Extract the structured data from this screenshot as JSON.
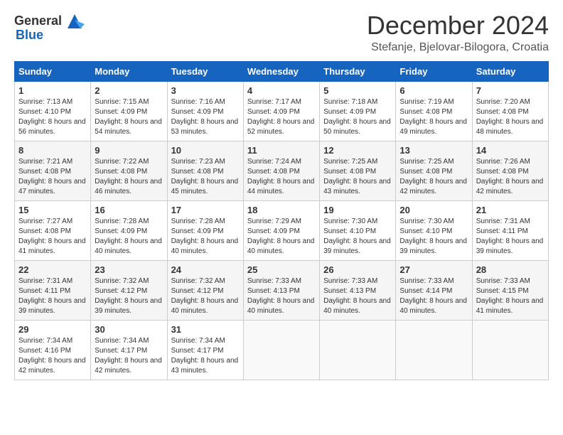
{
  "header": {
    "logo_general": "General",
    "logo_blue": "Blue",
    "month_title": "December 2024",
    "location": "Stefanje, Bjelovar-Bilogora, Croatia"
  },
  "days_of_week": [
    "Sunday",
    "Monday",
    "Tuesday",
    "Wednesday",
    "Thursday",
    "Friday",
    "Saturday"
  ],
  "weeks": [
    [
      {
        "day": "1",
        "sunrise": "7:13 AM",
        "sunset": "4:10 PM",
        "daylight": "8 hours and 56 minutes."
      },
      {
        "day": "2",
        "sunrise": "7:15 AM",
        "sunset": "4:09 PM",
        "daylight": "8 hours and 54 minutes."
      },
      {
        "day": "3",
        "sunrise": "7:16 AM",
        "sunset": "4:09 PM",
        "daylight": "8 hours and 53 minutes."
      },
      {
        "day": "4",
        "sunrise": "7:17 AM",
        "sunset": "4:09 PM",
        "daylight": "8 hours and 52 minutes."
      },
      {
        "day": "5",
        "sunrise": "7:18 AM",
        "sunset": "4:09 PM",
        "daylight": "8 hours and 50 minutes."
      },
      {
        "day": "6",
        "sunrise": "7:19 AM",
        "sunset": "4:08 PM",
        "daylight": "8 hours and 49 minutes."
      },
      {
        "day": "7",
        "sunrise": "7:20 AM",
        "sunset": "4:08 PM",
        "daylight": "8 hours and 48 minutes."
      }
    ],
    [
      {
        "day": "8",
        "sunrise": "7:21 AM",
        "sunset": "4:08 PM",
        "daylight": "8 hours and 47 minutes."
      },
      {
        "day": "9",
        "sunrise": "7:22 AM",
        "sunset": "4:08 PM",
        "daylight": "8 hours and 46 minutes."
      },
      {
        "day": "10",
        "sunrise": "7:23 AM",
        "sunset": "4:08 PM",
        "daylight": "8 hours and 45 minutes."
      },
      {
        "day": "11",
        "sunrise": "7:24 AM",
        "sunset": "4:08 PM",
        "daylight": "8 hours and 44 minutes."
      },
      {
        "day": "12",
        "sunrise": "7:25 AM",
        "sunset": "4:08 PM",
        "daylight": "8 hours and 43 minutes."
      },
      {
        "day": "13",
        "sunrise": "7:25 AM",
        "sunset": "4:08 PM",
        "daylight": "8 hours and 42 minutes."
      },
      {
        "day": "14",
        "sunrise": "7:26 AM",
        "sunset": "4:08 PM",
        "daylight": "8 hours and 42 minutes."
      }
    ],
    [
      {
        "day": "15",
        "sunrise": "7:27 AM",
        "sunset": "4:08 PM",
        "daylight": "8 hours and 41 minutes."
      },
      {
        "day": "16",
        "sunrise": "7:28 AM",
        "sunset": "4:09 PM",
        "daylight": "8 hours and 40 minutes."
      },
      {
        "day": "17",
        "sunrise": "7:28 AM",
        "sunset": "4:09 PM",
        "daylight": "8 hours and 40 minutes."
      },
      {
        "day": "18",
        "sunrise": "7:29 AM",
        "sunset": "4:09 PM",
        "daylight": "8 hours and 40 minutes."
      },
      {
        "day": "19",
        "sunrise": "7:30 AM",
        "sunset": "4:10 PM",
        "daylight": "8 hours and 39 minutes."
      },
      {
        "day": "20",
        "sunrise": "7:30 AM",
        "sunset": "4:10 PM",
        "daylight": "8 hours and 39 minutes."
      },
      {
        "day": "21",
        "sunrise": "7:31 AM",
        "sunset": "4:11 PM",
        "daylight": "8 hours and 39 minutes."
      }
    ],
    [
      {
        "day": "22",
        "sunrise": "7:31 AM",
        "sunset": "4:11 PM",
        "daylight": "8 hours and 39 minutes."
      },
      {
        "day": "23",
        "sunrise": "7:32 AM",
        "sunset": "4:12 PM",
        "daylight": "8 hours and 39 minutes."
      },
      {
        "day": "24",
        "sunrise": "7:32 AM",
        "sunset": "4:12 PM",
        "daylight": "8 hours and 40 minutes."
      },
      {
        "day": "25",
        "sunrise": "7:33 AM",
        "sunset": "4:13 PM",
        "daylight": "8 hours and 40 minutes."
      },
      {
        "day": "26",
        "sunrise": "7:33 AM",
        "sunset": "4:13 PM",
        "daylight": "8 hours and 40 minutes."
      },
      {
        "day": "27",
        "sunrise": "7:33 AM",
        "sunset": "4:14 PM",
        "daylight": "8 hours and 40 minutes."
      },
      {
        "day": "28",
        "sunrise": "7:33 AM",
        "sunset": "4:15 PM",
        "daylight": "8 hours and 41 minutes."
      }
    ],
    [
      {
        "day": "29",
        "sunrise": "7:34 AM",
        "sunset": "4:16 PM",
        "daylight": "8 hours and 42 minutes."
      },
      {
        "day": "30",
        "sunrise": "7:34 AM",
        "sunset": "4:17 PM",
        "daylight": "8 hours and 42 minutes."
      },
      {
        "day": "31",
        "sunrise": "7:34 AM",
        "sunset": "4:17 PM",
        "daylight": "8 hours and 43 minutes."
      },
      null,
      null,
      null,
      null
    ]
  ],
  "labels": {
    "sunrise": "Sunrise:",
    "sunset": "Sunset:",
    "daylight": "Daylight:"
  }
}
